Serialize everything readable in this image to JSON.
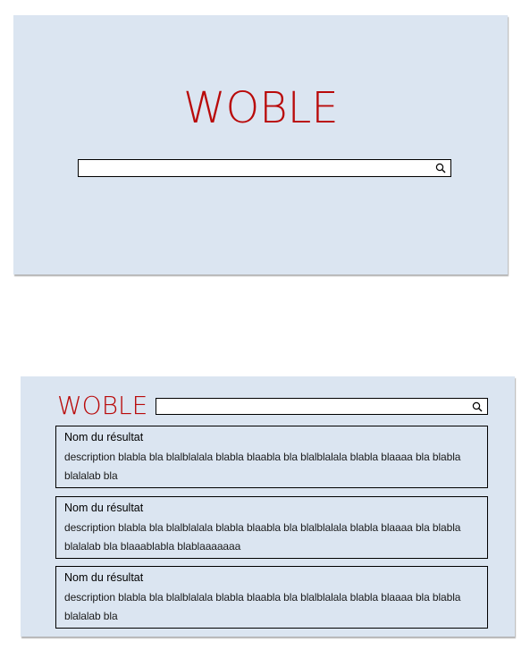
{
  "home": {
    "logo": "WOBLE",
    "search": {
      "value": "",
      "icon": "search-icon"
    }
  },
  "results_page": {
    "logo": "WOBLE",
    "search": {
      "value": "",
      "icon": "search-icon"
    },
    "results": [
      {
        "title": "Nom du résultat",
        "description": "description blabla bla blalblalala blabla blaabla bla blalblalala blabla blaaaa bla blabla blalalab bla"
      },
      {
        "title": "Nom du résultat",
        "description": "description blabla bla blalblalala blabla blaabla bla blalblalala blabla blaaaa bla blabla blalalab bla blaaablabla blablaaaaaaa"
      },
      {
        "title": "Nom du résultat",
        "description": "description blabla bla blalblalala blabla blaabla bla blalblalala blabla blaaaa bla blabla blalalab bla"
      }
    ]
  },
  "colors": {
    "brand": "#b90a0a",
    "panel_bg": "#dbe5f1"
  }
}
